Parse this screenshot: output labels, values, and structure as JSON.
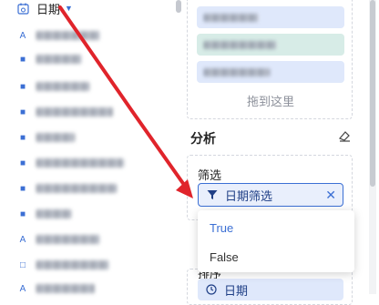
{
  "field_list": {
    "date_field_label": "日期"
  },
  "drop_zone": {
    "placeholder": "拖到这里"
  },
  "analysis": {
    "title": "分析",
    "filter_label": "筛选",
    "filter_pill_label": "日期筛选",
    "options": [
      "True",
      "False"
    ],
    "sort_label": "排序",
    "sort_pill_label": "日期"
  },
  "colors": {
    "accent": "#3b6fd4",
    "pill_bg": "#e9effc",
    "annotation_red": "#e0242b"
  }
}
